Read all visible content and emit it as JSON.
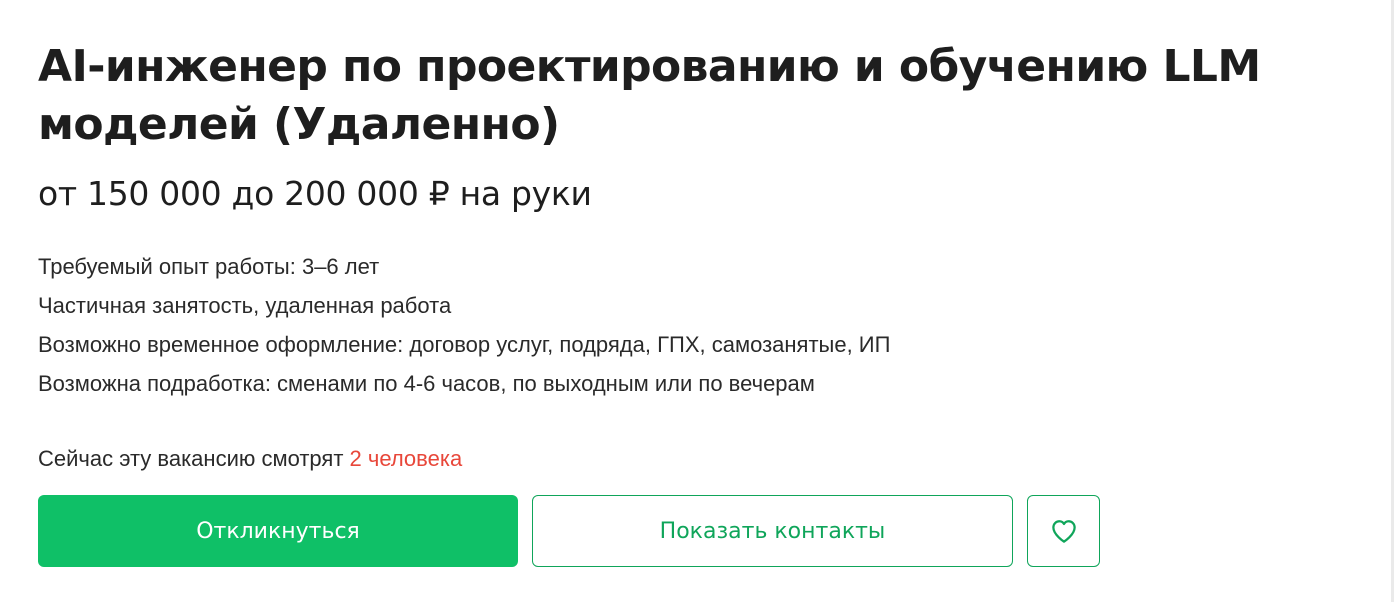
{
  "vacancy": {
    "title": "AI-инженер по проектированию и обучению LLM моделей (Удаленно)",
    "salary": "от 150 000 до 200 000 ₽ на руки",
    "details": [
      "Требуемый опыт работы: 3–6 лет",
      "Частичная занятость, удаленная работа",
      "Возможно временное оформление: договор услуг, подряда, ГПХ, самозанятые, ИП",
      "Возможна подработка: сменами по 4-6 часов, по выходным или по вечерам"
    ],
    "viewers_prefix": "Сейчас эту вакансию смотрят",
    "viewers_count": "2 человека"
  },
  "actions": {
    "respond_label": "Откликнуться",
    "contacts_label": "Показать контакты",
    "favorite_icon": "heart-icon"
  },
  "colors": {
    "primary_green": "#0fc067",
    "outline_green": "#0fa55a",
    "viewers_count": "#e8473a"
  }
}
